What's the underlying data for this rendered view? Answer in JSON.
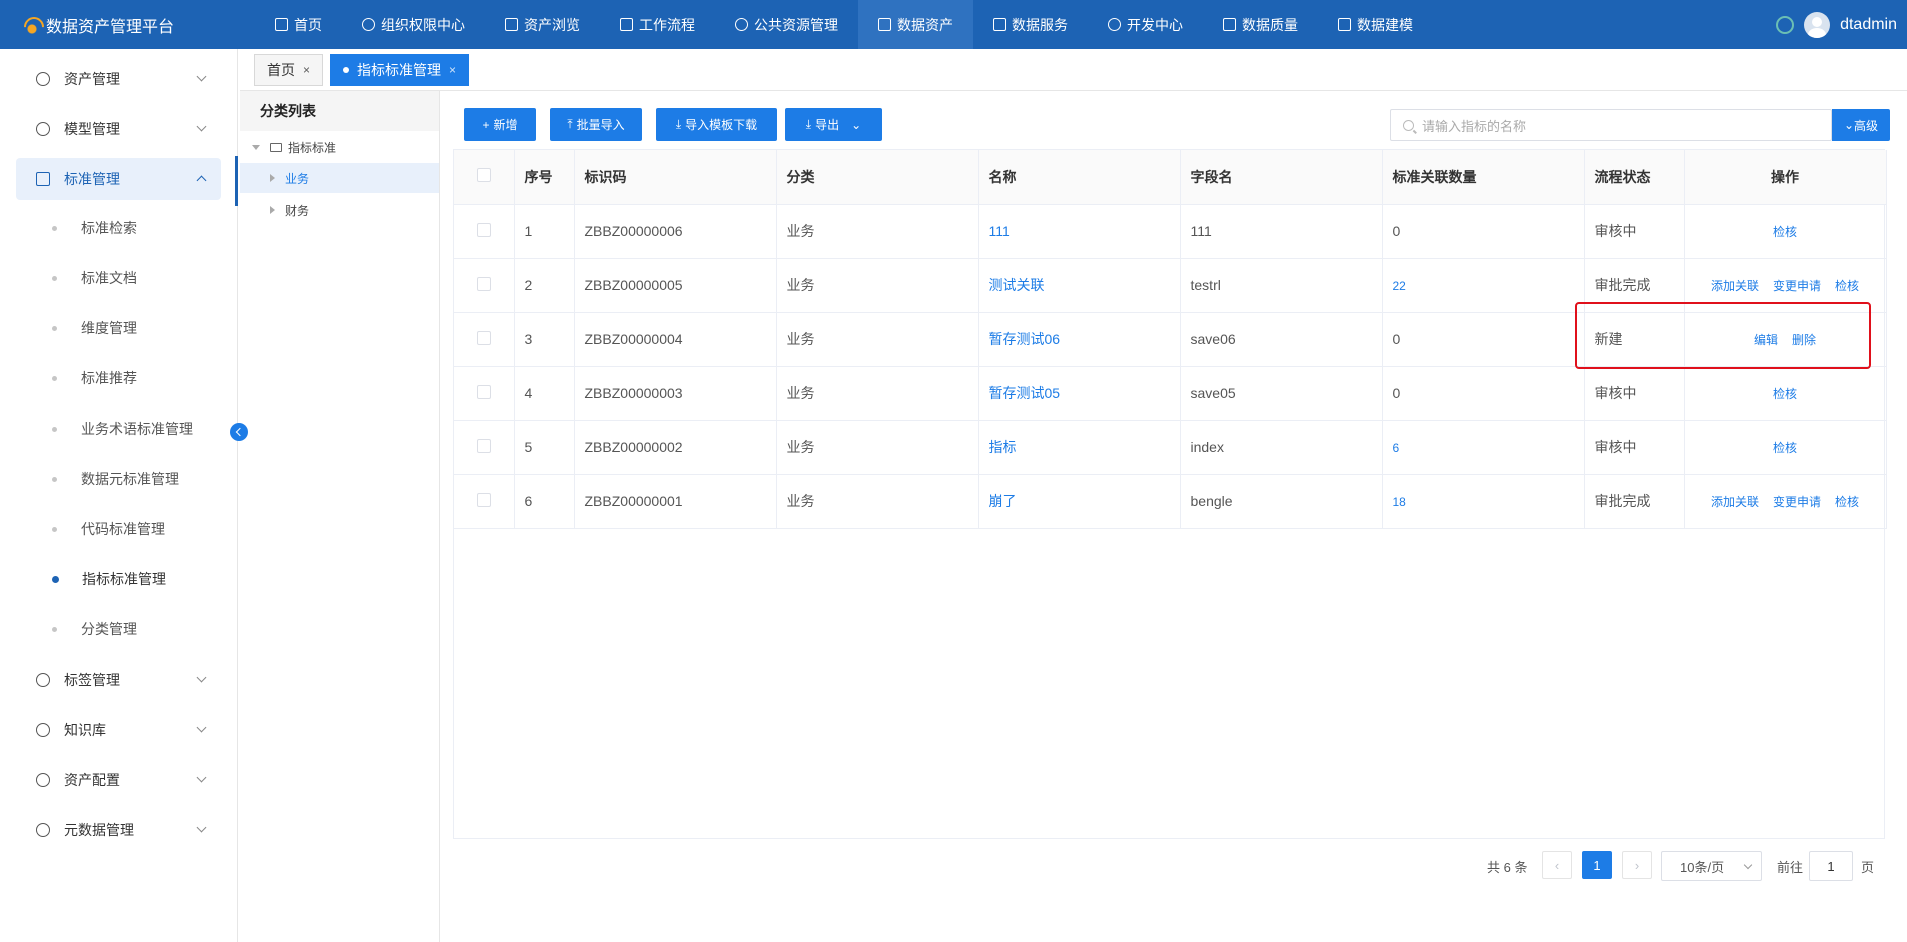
{
  "app": {
    "title": "数据资产管理平台",
    "username": "dtadmin"
  },
  "topnav": [
    {
      "label": "首页",
      "icon": "document-icon"
    },
    {
      "label": "组织权限中心",
      "icon": "heart-shield-icon"
    },
    {
      "label": "资产浏览",
      "icon": "grid-icon"
    },
    {
      "label": "工作流程",
      "icon": "balance-icon"
    },
    {
      "label": "公共资源管理",
      "icon": "gamepad-icon"
    },
    {
      "label": "数据资产",
      "icon": "chat-icon",
      "active": true
    },
    {
      "label": "数据服务",
      "icon": "chart-icon"
    },
    {
      "label": "开发中心",
      "icon": "edit-icon"
    },
    {
      "label": "数据质量",
      "icon": "bar-chart-icon"
    },
    {
      "label": "数据建模",
      "icon": "layers-icon"
    }
  ],
  "sidebar": {
    "menus": [
      {
        "label": "资产管理"
      },
      {
        "label": "模型管理"
      },
      {
        "label": "标准管理",
        "active": true
      },
      {
        "label": "标签管理"
      },
      {
        "label": "知识库"
      },
      {
        "label": "资产配置"
      },
      {
        "label": "元数据管理"
      }
    ],
    "subitems": [
      {
        "label": "标准检索"
      },
      {
        "label": "标准文档"
      },
      {
        "label": "维度管理"
      },
      {
        "label": "标准推荐"
      },
      {
        "label": "业务术语标准管理"
      },
      {
        "label": "数据元标准管理"
      },
      {
        "label": "代码标准管理"
      },
      {
        "label": "指标标准管理",
        "active": true
      },
      {
        "label": "分类管理"
      }
    ]
  },
  "tabs": [
    {
      "label": "首页",
      "close": "×"
    },
    {
      "label": "指标标准管理",
      "close": "×",
      "active": true
    }
  ],
  "category": {
    "title": "分类列表",
    "root": "指标标准",
    "children": [
      "业务",
      "财务"
    ]
  },
  "toolbar": {
    "add": "新增",
    "batch_import": "批量导入",
    "template_download": "导入模板下载",
    "export": "导出",
    "search_placeholder": "请输入指标的名称",
    "advanced": "高级"
  },
  "table": {
    "headers": [
      "序号",
      "标识码",
      "分类",
      "名称",
      "字段名",
      "标准关联数量",
      "流程状态",
      "操作"
    ],
    "rows": [
      {
        "no": "1",
        "code": "ZBBZ00000006",
        "cat": "业务",
        "name": "111",
        "field": "111",
        "count": "0",
        "count_link": false,
        "status": "审核中",
        "actions": [
          "检核"
        ]
      },
      {
        "no": "2",
        "code": "ZBBZ00000005",
        "cat": "业务",
        "name": "测试关联",
        "field": "testrl",
        "count": "22",
        "count_link": true,
        "status": "审批完成",
        "actions": [
          "添加关联",
          "变更申请",
          "检核"
        ]
      },
      {
        "no": "3",
        "code": "ZBBZ00000004",
        "cat": "业务",
        "name": "暂存测试06",
        "field": "save06",
        "count": "0",
        "count_link": false,
        "status": "新建",
        "actions": [
          "编辑",
          "删除"
        ]
      },
      {
        "no": "4",
        "code": "ZBBZ00000003",
        "cat": "业务",
        "name": "暂存测试05",
        "field": "save05",
        "count": "0",
        "count_link": false,
        "status": "审核中",
        "actions": [
          "检核"
        ]
      },
      {
        "no": "5",
        "code": "ZBBZ00000002",
        "cat": "业务",
        "name": "指标",
        "field": "index",
        "count": "6",
        "count_link": true,
        "status": "审核中",
        "actions": [
          "检核"
        ]
      },
      {
        "no": "6",
        "code": "ZBBZ00000001",
        "cat": "业务",
        "name": "崩了",
        "field": "bengle",
        "count": "18",
        "count_link": true,
        "status": "审批完成",
        "actions": [
          "添加关联",
          "变更申请",
          "检核"
        ]
      }
    ]
  },
  "pagination": {
    "total": "共 6 条",
    "current": "1",
    "page_size": "10条/页",
    "goto_prefix": "前往",
    "goto_value": "1",
    "goto_suffix": "页"
  },
  "colors": {
    "primary": "#1d7ce6",
    "header": "#1d63b4",
    "highlight": "#e0101b"
  }
}
